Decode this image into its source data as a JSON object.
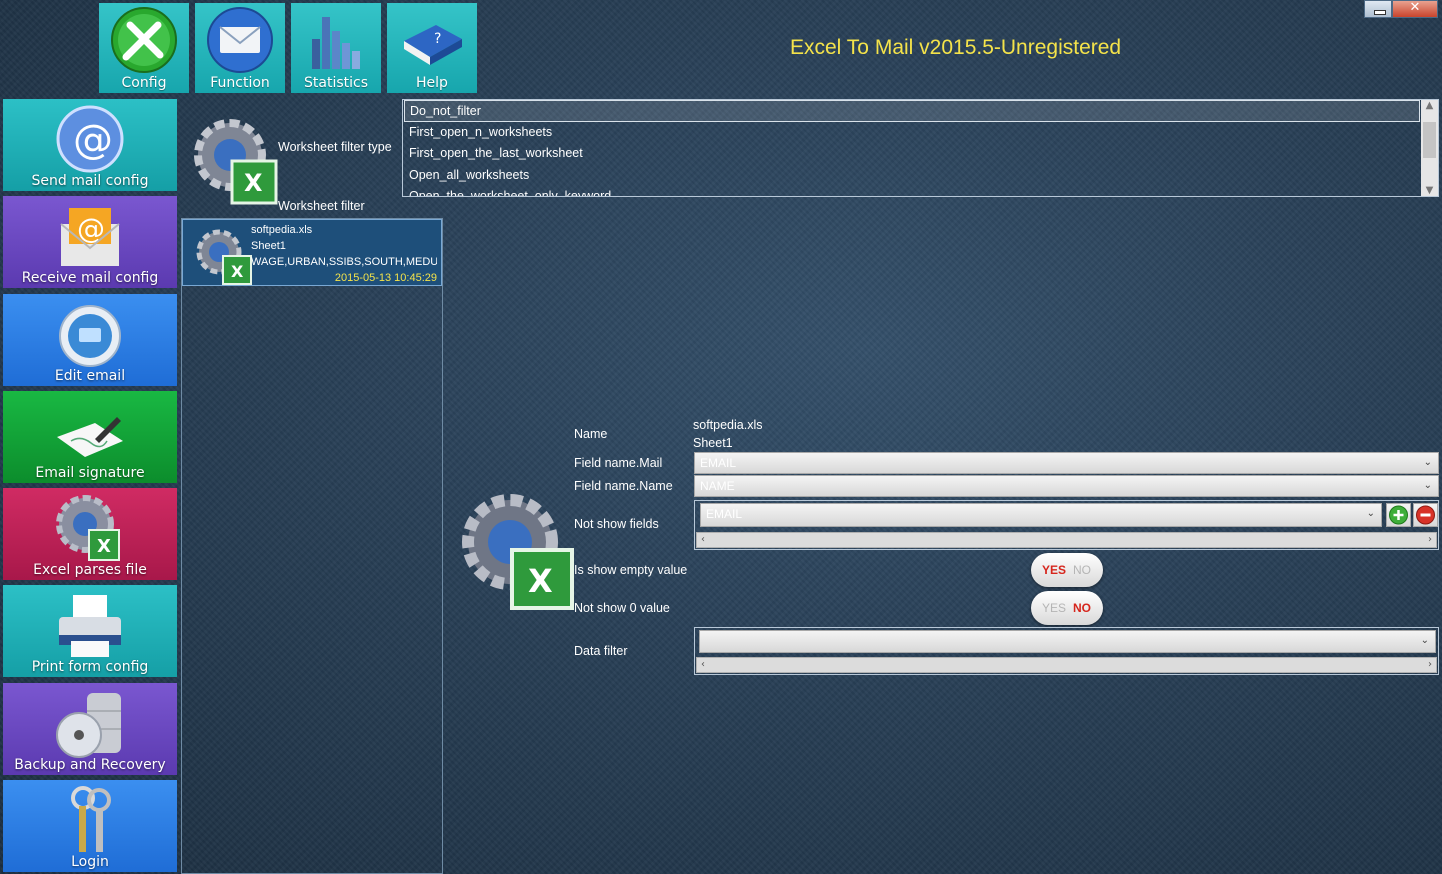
{
  "app": {
    "title": "Excel To Mail v2015.5-Unregistered"
  },
  "toolbar": [
    {
      "label": "Config",
      "icon": "wrench-icon"
    },
    {
      "label": "Function",
      "icon": "envelope-icon"
    },
    {
      "label": "Statistics",
      "icon": "bar-chart-icon"
    },
    {
      "label": "Help",
      "icon": "help-book-icon"
    }
  ],
  "sidebar": [
    {
      "label": "Send mail config",
      "icon": "at-sign-icon",
      "color": "#21b2b8"
    },
    {
      "label": "Receive mail config",
      "icon": "mail-envelope-icon",
      "color": "#6a4bc0"
    },
    {
      "label": "Edit email",
      "icon": "edit-email-icon",
      "color": "#2b7fe6"
    },
    {
      "label": "Email signature",
      "icon": "signature-icon",
      "color": "#13a23a"
    },
    {
      "label": "Excel parses file",
      "icon": "gear-excel-icon",
      "color": "#c5255a"
    },
    {
      "label": "Print form config",
      "icon": "printer-icon",
      "color": "#21b2b8"
    },
    {
      "label": "Backup and Recovery",
      "icon": "database-disc-icon",
      "color": "#6a4bc0"
    },
    {
      "label": "Login",
      "icon": "keys-icon",
      "color": "#2b7fe6"
    }
  ],
  "worksheet": {
    "filter_type_label": "Worksheet filter type",
    "filter_label": "Worksheet filter",
    "filter_options": [
      "Do_not_filter",
      "First_open_n_worksheets",
      "First_open_the_last_worksheet",
      "Open_all_worksheets",
      "Open_the_worksheet_only_keyword"
    ]
  },
  "file_item": {
    "name": "softpedia.xls",
    "sheet": "Sheet1",
    "fields": "WAGE,URBAN,SSIBS,SOUTH,MEDUC",
    "date": "2015-05-13 10:45:29"
  },
  "form": {
    "name_label": "Name",
    "name_value_file": "softpedia.xls",
    "name_value_sheet": "Sheet1",
    "field_mail_label": "Field name.Mail",
    "field_mail_value": "EMAIL",
    "field_name_label": "Field name.Name",
    "field_name_value": "NAME",
    "not_show_fields_label": "Not show fields",
    "not_show_fields_value": "EMAIL",
    "show_empty_label": "Is show empty value",
    "show_empty_yes": "YES",
    "show_empty_no": "NO",
    "show_empty_state": "yes",
    "not_show_zero_label": "Not show 0 value",
    "not_show_zero_yes": "YES",
    "not_show_zero_no": "NO",
    "not_show_zero_state": "no",
    "data_filter_label": "Data filter",
    "data_filter_value": ""
  }
}
